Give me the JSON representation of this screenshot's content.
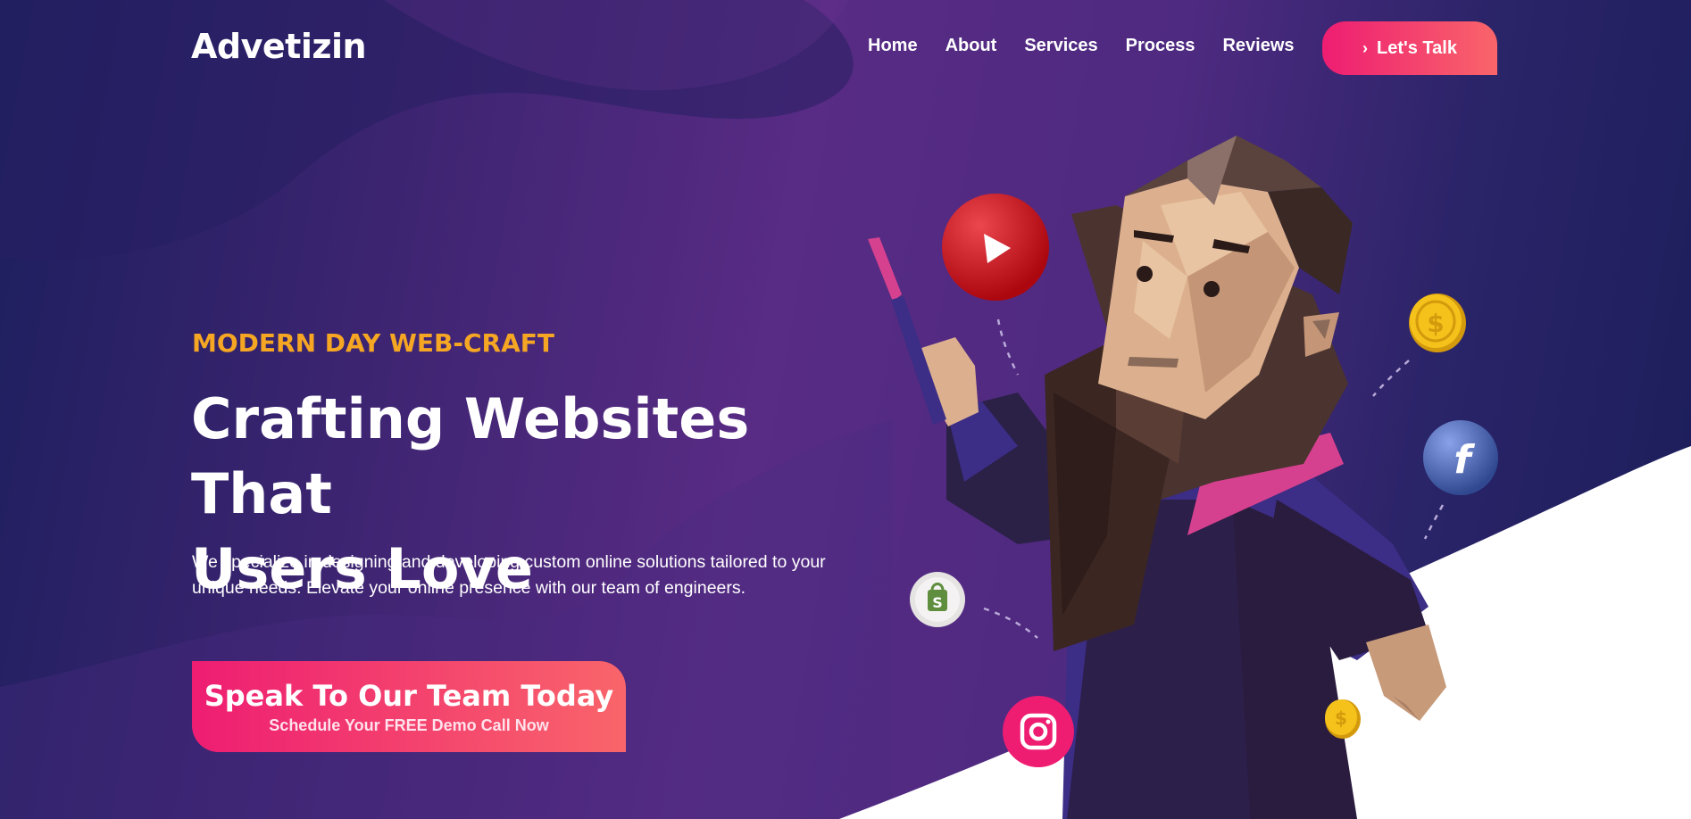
{
  "brand": {
    "logo": "Advetizin"
  },
  "nav": {
    "items": [
      {
        "label": "Home"
      },
      {
        "label": "About"
      },
      {
        "label": "Services"
      },
      {
        "label": "Process"
      },
      {
        "label": "Reviews"
      }
    ],
    "cta_label": "Let's Talk",
    "cta_icon": "chevron-right-icon"
  },
  "hero": {
    "eyebrow": "MODERN DAY WEB-CRAFT",
    "headline_line1": "Crafting Websites That",
    "headline_line2": "Users Love",
    "description": "We specialize in designing and developing custom online solutions tailored to your unique needs. Elevate your online presence with our team of engineers.",
    "cta_main": "Speak To Our Team Today",
    "cta_sub": "Schedule Your FREE Demo Call Now"
  },
  "illustration": {
    "character": "low-poly bearded wizard in purple robe",
    "icons": [
      "youtube-icon",
      "shopify-icon",
      "instagram-icon",
      "facebook-icon",
      "dollar-coin-icon",
      "dollar-coin-icon"
    ]
  },
  "colors": {
    "accent_orange": "#f5a623",
    "button_gradient_start": "#ee1d72",
    "button_gradient_end": "#f9656a",
    "bg_deep": "#1c1f5e",
    "bg_purple": "#582b84"
  }
}
